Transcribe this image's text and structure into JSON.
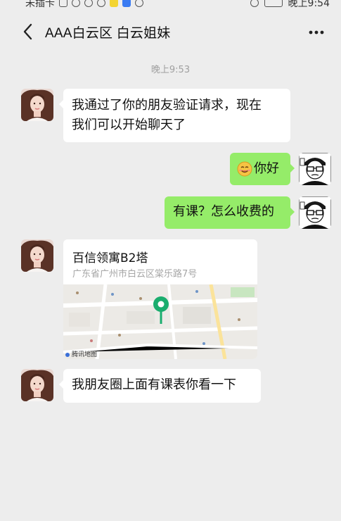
{
  "status_bar": {
    "left_text": "未插卡",
    "right_text": "晚上9:54"
  },
  "header": {
    "title": "AAA白云区 白云姐妹"
  },
  "time_divider": "晚上9:53",
  "messages": [
    {
      "side": "left",
      "type": "text",
      "text_line1": "我通过了你的朋友验证请求，现在",
      "text_line2": "我们可以开始聊天了"
    },
    {
      "side": "right",
      "type": "text",
      "emoji": "smile-emoji",
      "text": "你好"
    },
    {
      "side": "right",
      "type": "text",
      "text": "有课？怎么收费的"
    },
    {
      "side": "left",
      "type": "location",
      "name": "百信领寓B2塔",
      "address": "广东省广州市白云区棠乐路7号",
      "map_credit": "腾讯地图"
    },
    {
      "side": "left",
      "type": "text",
      "text": "我朋友圈上面有课表你看一下"
    }
  ],
  "colors": {
    "background": "#ededed",
    "bubble_self": "#95ec69",
    "bubble_other": "#ffffff",
    "map_pin": "#1aad6e"
  }
}
